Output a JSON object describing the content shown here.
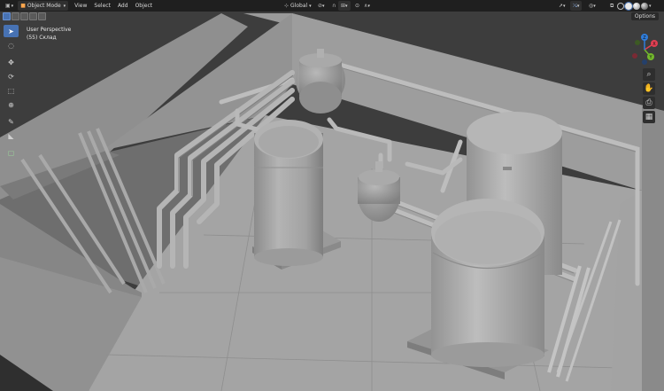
{
  "header": {
    "mode_label": "Object Mode",
    "menus": [
      "View",
      "Select",
      "Add",
      "Object"
    ],
    "transform_orientation": "Global",
    "options_label": "Options"
  },
  "viewport": {
    "perspective_label": "User Perspective",
    "collection_label": "(55) Склад"
  },
  "gizmo": {
    "axis_labels": [
      "X",
      "Y",
      "Z"
    ],
    "colors": {
      "x": "#e23f52",
      "y": "#73b82c",
      "z": "#2f7ddb",
      "neg": "#555555"
    }
  },
  "toolbar": {
    "tools": [
      "select-box",
      "cursor",
      "move",
      "rotate",
      "scale",
      "transform",
      "annotate",
      "measure",
      "add-cube"
    ]
  },
  "colors": {
    "accent": "#4772b3",
    "header_bg": "#1f1f1f",
    "model_gray": "#a6a6a6"
  }
}
